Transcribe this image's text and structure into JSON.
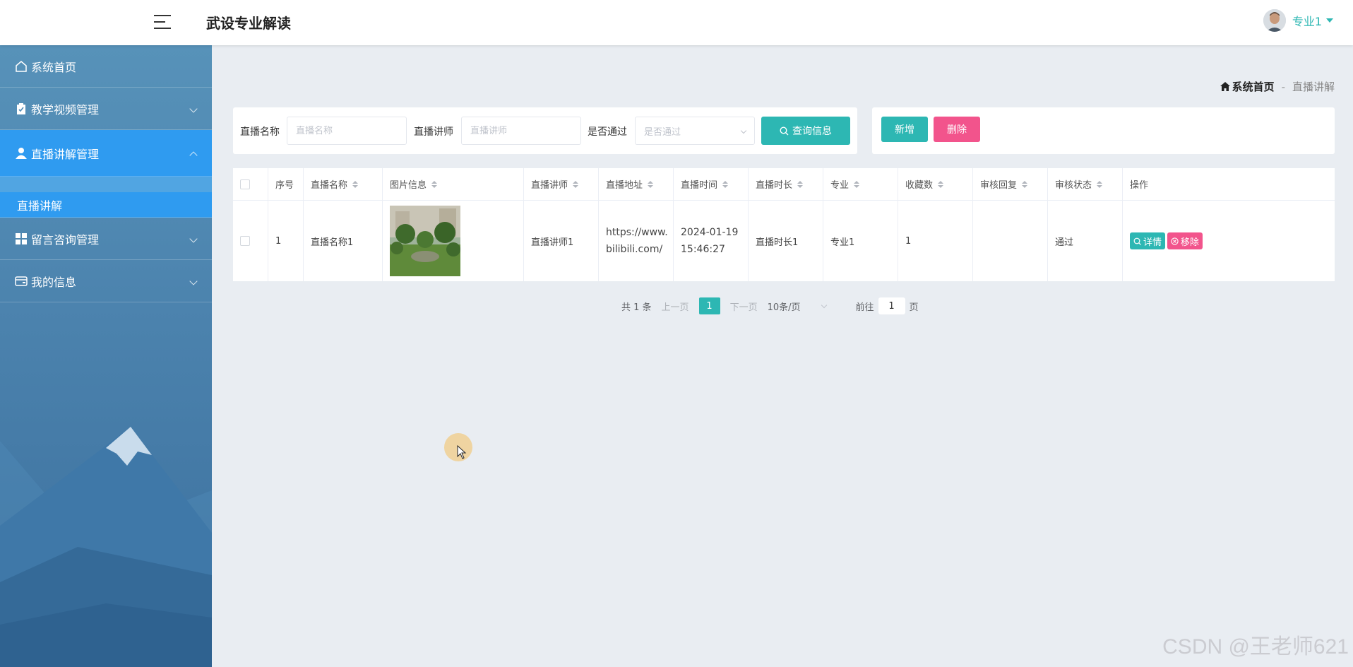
{
  "header": {
    "title": "武设专业解读",
    "user_name": "专业1"
  },
  "sidebar": {
    "items": [
      {
        "label": "系统首页",
        "icon": "home-icon"
      },
      {
        "label": "教学视频管理",
        "icon": "clipboard-check-icon"
      },
      {
        "label": "直播讲解管理",
        "icon": "user-icon",
        "active": true
      },
      {
        "label": "留言咨询管理",
        "icon": "grid-icon"
      },
      {
        "label": "我的信息",
        "icon": "card-icon"
      }
    ],
    "submenu": {
      "label": "直播讲解"
    }
  },
  "breadcrumb": {
    "home": "系统首页",
    "separator": "-",
    "current": "直播讲解"
  },
  "search": {
    "name_label": "直播名称",
    "name_placeholder": "直播名称",
    "teacher_label": "直播讲师",
    "teacher_placeholder": "直播讲师",
    "pass_label": "是否通过",
    "pass_placeholder": "是否通过",
    "query_button": "查询信息"
  },
  "actions": {
    "add_button": "新增",
    "delete_button": "删除"
  },
  "table": {
    "columns": [
      "序号",
      "直播名称",
      "图片信息",
      "直播讲师",
      "直播地址",
      "直播时间",
      "直播时长",
      "专业",
      "收藏数",
      "审核回复",
      "审核状态",
      "操作"
    ],
    "rows": [
      {
        "index": "1",
        "name": "直播名称1",
        "teacher": "直播讲师1",
        "url_line1": "https://www.",
        "url_line2": "bilibili.com/",
        "date": "2024-01-19",
        "time": "15:46:27",
        "duration": "直播时长1",
        "major": "专业1",
        "favorites": "1",
        "reply": "",
        "status": "通过",
        "detail_button": "详情",
        "remove_button": "移除"
      }
    ]
  },
  "pagination": {
    "total": "共 1 条",
    "prev": "上一页",
    "current": "1",
    "next": "下一页",
    "page_size": "10条/页",
    "goto_prefix": "前往",
    "goto_value": "1",
    "goto_suffix": "页"
  },
  "watermark": "CSDN @王老师621",
  "colors": {
    "accent": "#2db7b3",
    "danger": "#f2548c",
    "sidebar_active": "#2f9bf0"
  }
}
